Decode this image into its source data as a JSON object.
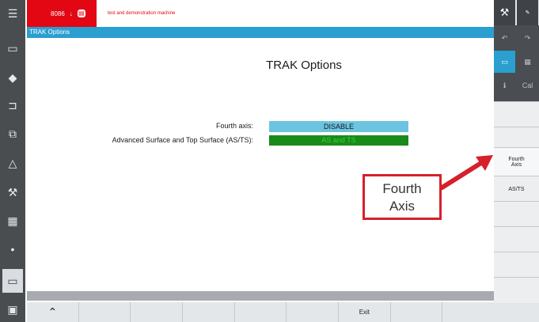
{
  "header": {
    "mode": "8086",
    "machine_description": "test and demonstration machine",
    "title_strip": "TRAK Options"
  },
  "main": {
    "page_title": "TRAK Options",
    "options": [
      {
        "label": "Fourth axis:",
        "value": "DISABLE",
        "color": "#6cc4e0"
      },
      {
        "label": "Advanced Surface and Top Surface (AS/TS):",
        "value": "AS and TS",
        "color": "#1a8a1a"
      }
    ]
  },
  "callout": {
    "line1": "Fourth",
    "line2": "Axis",
    "color": "#d6202a"
  },
  "right_softkeys": [
    {
      "label": "Fourth\nAxis"
    },
    {
      "label": "AS/TS"
    }
  ],
  "right_top": {
    "mini_right": "Cal"
  },
  "bottom_softkeys": {
    "exit_label": "Exit",
    "up_icon": "chevron-up-icon"
  },
  "colors": {
    "accent_red": "#e30613",
    "title_blue": "#2a9fd0"
  }
}
